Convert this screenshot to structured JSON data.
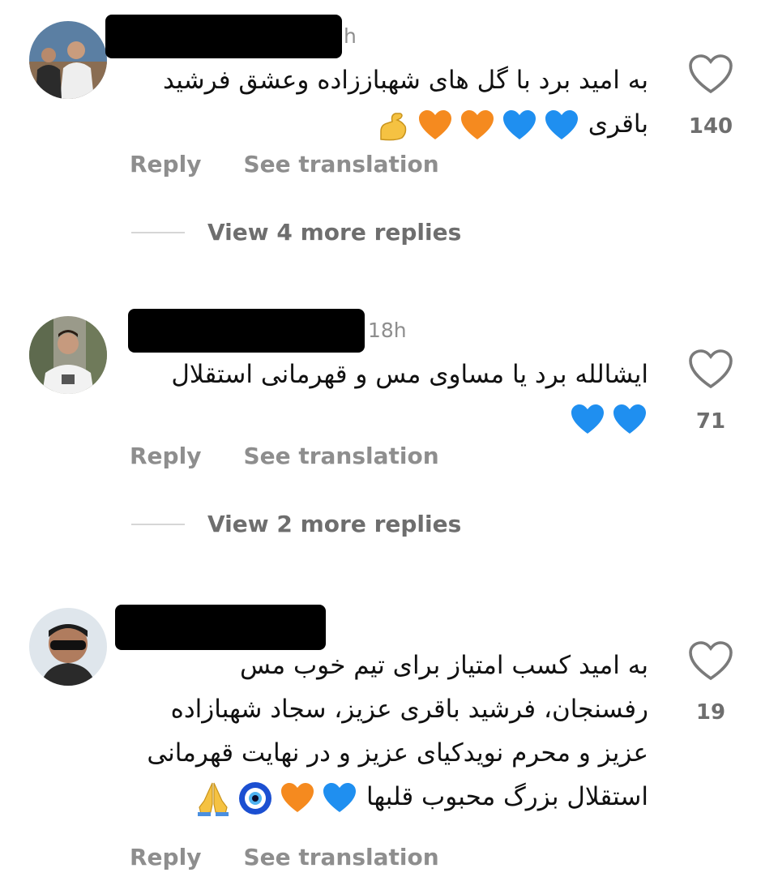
{
  "comments": [
    {
      "time": "h",
      "text": "به امید برد با گل های شهباززاده وعشق فرشید باقری",
      "emojis": [
        "flexed-biceps",
        "orange-heart",
        "orange-heart",
        "blue-heart",
        "blue-heart"
      ],
      "likes": "140",
      "reply": "Reply",
      "translate": "See translation",
      "more_replies": "View 4 more replies"
    },
    {
      "time": "18h",
      "text": "ایشالله برد یا مساوی مس و قهرمانی استقلال",
      "emojis": [
        "blue-heart",
        "blue-heart"
      ],
      "likes": "71",
      "reply": "Reply",
      "translate": "See translation",
      "more_replies": "View 2 more replies"
    },
    {
      "time": "",
      "text": "به امید کسب امتیاز برای تیم خوب مس رفسنجان، فرشید باقری عزیز، سجاد شهبازاده عزیز و محرم نویدکیای عزیز و در نهایت قهرمانی استقلال بزرگ محبوب قلبها",
      "emojis": [
        "blue-heart",
        "orange-heart",
        "nazar-amulet",
        "folded-hands"
      ],
      "likes": "19",
      "reply": "Reply",
      "translate": "See translation"
    }
  ],
  "colors": {
    "orange_heart": "#f58a1f",
    "blue_heart": "#1f8ff0",
    "secondary_text": "#8e8e8e"
  }
}
